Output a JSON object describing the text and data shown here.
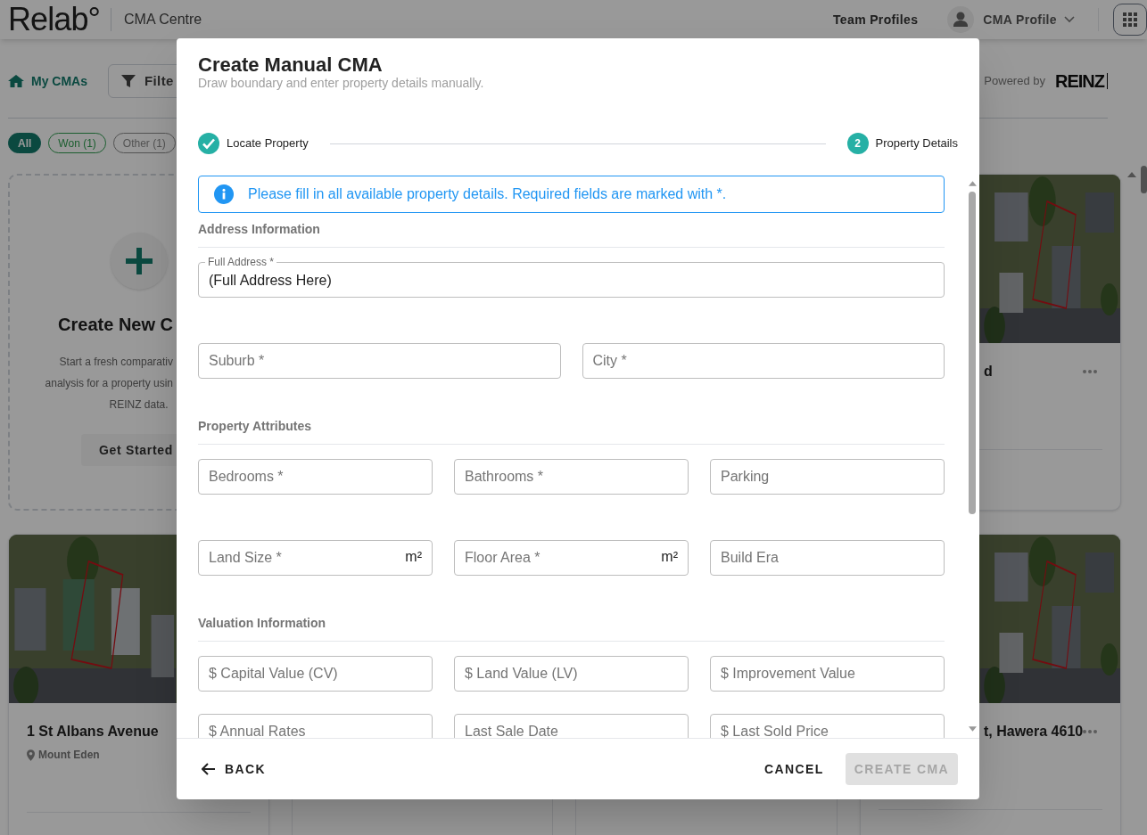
{
  "app_bar": {
    "logo": "Relab°",
    "section": "CMA Centre",
    "team_link": "Team Profiles",
    "profile": "CMA Profile"
  },
  "toolbar": {
    "home_link": "My CMAs",
    "filter_button": "Filte",
    "powered_by": "Powered by",
    "brand": "REINZ"
  },
  "filters": [
    {
      "label": "All",
      "selected": true
    },
    {
      "label": "Won (1)",
      "selected": false
    },
    {
      "label": "Other (1)",
      "selected": false
    }
  ],
  "create_card": {
    "title": "Create New C",
    "lines": [
      "Start a fresh comparativ",
      "analysis for a property usin",
      "REINZ data."
    ],
    "button": "Get Started"
  },
  "cards": [
    {
      "title": "d"
    },
    {
      "title": "1 St Albans Avenue",
      "location": "Mount Eden"
    },
    {
      "title": "t, Hawera 4610"
    }
  ],
  "dialog": {
    "title": "Create Manual CMA",
    "subtitle": "Draw boundary and enter property details manually.",
    "steps": [
      {
        "label": "Locate Property",
        "completed": true
      },
      {
        "label": "Property Details",
        "number": "2",
        "completed": false
      }
    ],
    "alert": "Please fill in all available property details. Required fields are marked with *.",
    "sections": [
      {
        "heading": "Address Information",
        "rows": [
          [
            {
              "kind": "labeled",
              "label": "Full Address *",
              "value": "(Full Address Here)"
            }
          ],
          [
            {
              "kind": "plain",
              "placeholder": "Suburb *"
            },
            {
              "kind": "plain",
              "placeholder": "City *"
            }
          ]
        ]
      },
      {
        "heading": "Property Attributes",
        "rows": [
          [
            {
              "kind": "plain",
              "placeholder": "Bedrooms *"
            },
            {
              "kind": "plain",
              "placeholder": "Bathrooms *"
            },
            {
              "kind": "plain",
              "placeholder": "Parking"
            }
          ],
          [
            {
              "kind": "unit",
              "placeholder": "Land Size *",
              "unit": "m²"
            },
            {
              "kind": "unit",
              "placeholder": "Floor Area *",
              "unit": "m²"
            },
            {
              "kind": "plain",
              "placeholder": "Build Era"
            }
          ]
        ]
      },
      {
        "heading": "Valuation Information",
        "rows": [
          [
            {
              "kind": "plain",
              "placeholder": "$ Capital Value (CV)"
            },
            {
              "kind": "plain",
              "placeholder": "$ Land Value (LV)"
            },
            {
              "kind": "plain",
              "placeholder": "$ Improvement Value"
            }
          ],
          [
            {
              "kind": "plain",
              "placeholder": "$ Annual Rates"
            },
            {
              "kind": "plain",
              "placeholder": "Last Sale Date"
            },
            {
              "kind": "plain",
              "placeholder": "$ Last Sold Price"
            }
          ]
        ]
      }
    ],
    "back": "BACK",
    "cancel": "CANCEL",
    "submit": {
      "label": "CREATE CMA",
      "disabled": true
    }
  }
}
